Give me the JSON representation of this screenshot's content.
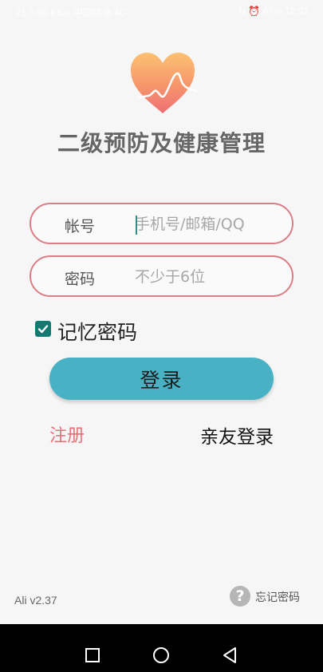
{
  "status_bar": {
    "left_text": "21 0.00 KB/s  中国联通  4G",
    "right_text": "N  ⏰  67%  12:32"
  },
  "app": {
    "title": "二级预防及健康管理"
  },
  "login_form": {
    "account_label": "帐号",
    "account_placeholder": "手机号/邮箱/QQ",
    "account_value": "",
    "password_label": "密码",
    "password_placeholder": "不少于6位",
    "password_value": "",
    "remember_label": "记忆密码",
    "remember_checked": true,
    "login_label": "登录"
  },
  "links": {
    "register": "注册",
    "family_login": "亲友登录",
    "forgot_password": "忘记密码",
    "help_glyph": "?"
  },
  "footer": {
    "version": "Ali v2.37"
  },
  "colors": {
    "field_border": "#db7d86",
    "login_button": "#48b1c3",
    "register_link": "#e5707a",
    "checkbox": "#127a70"
  },
  "icons": {
    "logo": "heart-pulse-icon",
    "recent": "square-icon",
    "home": "circle-icon",
    "back": "triangle-back-icon"
  }
}
